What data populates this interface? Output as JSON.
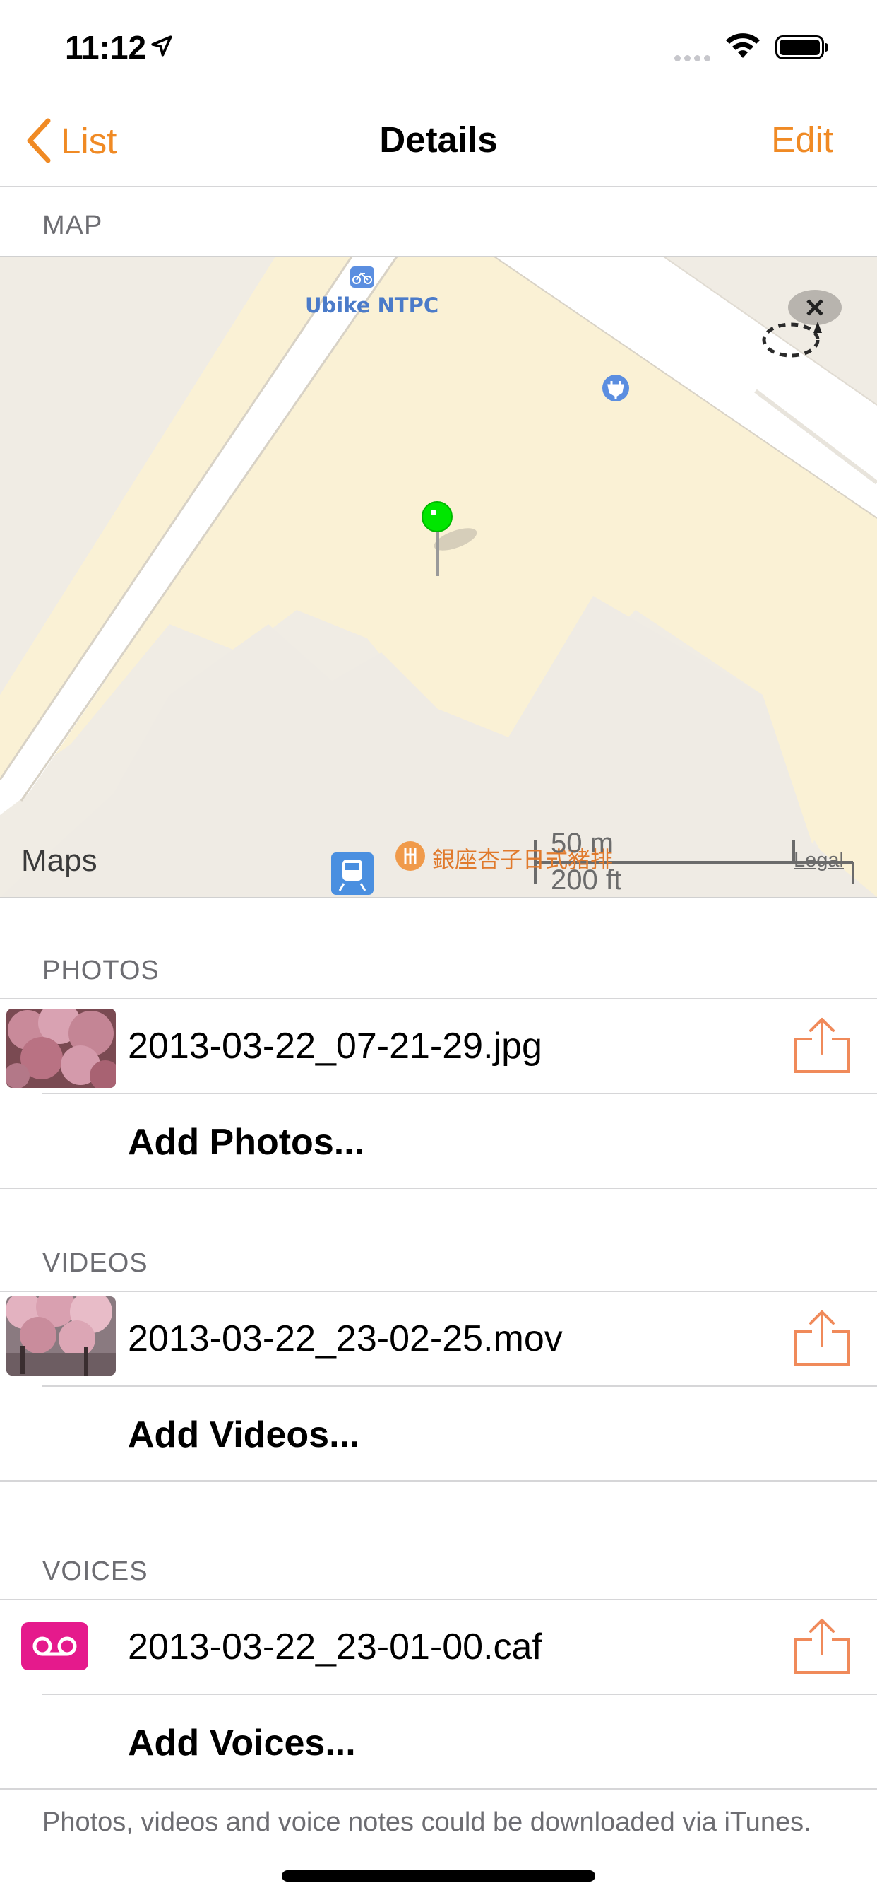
{
  "status_bar": {
    "time": "11:12"
  },
  "nav": {
    "back_label": "List",
    "title": "Details",
    "edit_label": "Edit"
  },
  "sections": {
    "map": "MAP",
    "photos": "PHOTOS",
    "videos": "VIDEOS",
    "voices": "VOICES"
  },
  "map": {
    "poi_bike": "Ubike NTPC",
    "restaurant": "銀座杏子日式豬排",
    "logo_text": "Maps",
    "scale_metric": "50 m",
    "scale_imperial": "200 ft",
    "legal": "Legal",
    "pin_color": "#00e600"
  },
  "photos": {
    "file": "2013-03-22_07-21-29.jpg",
    "add_label": "Add Photos..."
  },
  "videos": {
    "file": "2013-03-22_23-02-25.mov",
    "add_label": "Add Videos..."
  },
  "voices": {
    "file": "2013-03-22_23-01-00.caf",
    "add_label": "Add Voices..."
  },
  "footer": "Photos, videos and voice notes could be downloaded via iTunes.",
  "colors": {
    "accent": "#f08a24",
    "voice": "#e51a8c"
  },
  "icons": [
    "location-arrow-icon",
    "wifi-icon",
    "battery-icon",
    "chevron-left-icon",
    "share-icon",
    "voicemail-icon",
    "bike-icon",
    "charging-icon",
    "train-icon",
    "restaurant-icon",
    "pin-icon"
  ]
}
